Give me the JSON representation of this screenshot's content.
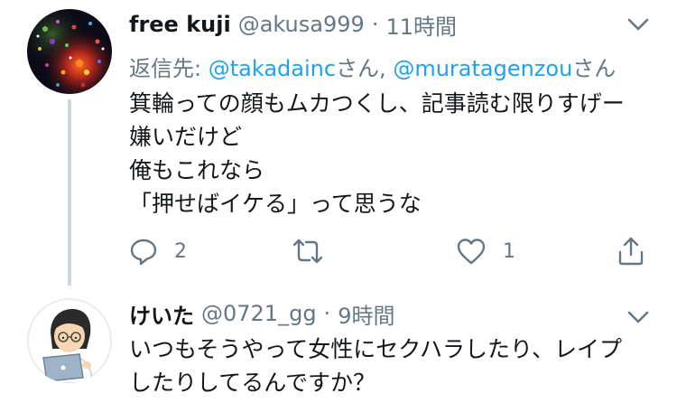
{
  "tweets": [
    {
      "display_name": "free kuji",
      "handle": "@akusa999",
      "separator": "·",
      "time": "11時間",
      "reply_to": {
        "prefix": "返信先: ",
        "mention1": "@takadainc",
        "suffix1": "さん, ",
        "mention2": "@muratagenzou",
        "suffix2": "さん"
      },
      "body_lines": [
        "箕輪っての顔もムカつくし、記事読む限りすげー",
        "嫌いだけど",
        "俺もこれなら",
        "「押せばイケる」って思うな"
      ],
      "actions": {
        "reply_count": "2",
        "retweet_count": "",
        "like_count": "1"
      },
      "avatar_icon": "starry-photo-avatar"
    },
    {
      "display_name": "けいた",
      "handle": "@0721_gg",
      "separator": "·",
      "time": "9時間",
      "body_lines": [
        "いつもそうやって女性にセクハラしたり、レイプ",
        "したりしてるんですか？"
      ],
      "avatar_icon": "person-with-laptop-avatar"
    }
  ],
  "colors": {
    "text": "#14171a",
    "secondary": "#657786",
    "link": "#1da1f2",
    "thread_line": "#ccd6dd"
  }
}
